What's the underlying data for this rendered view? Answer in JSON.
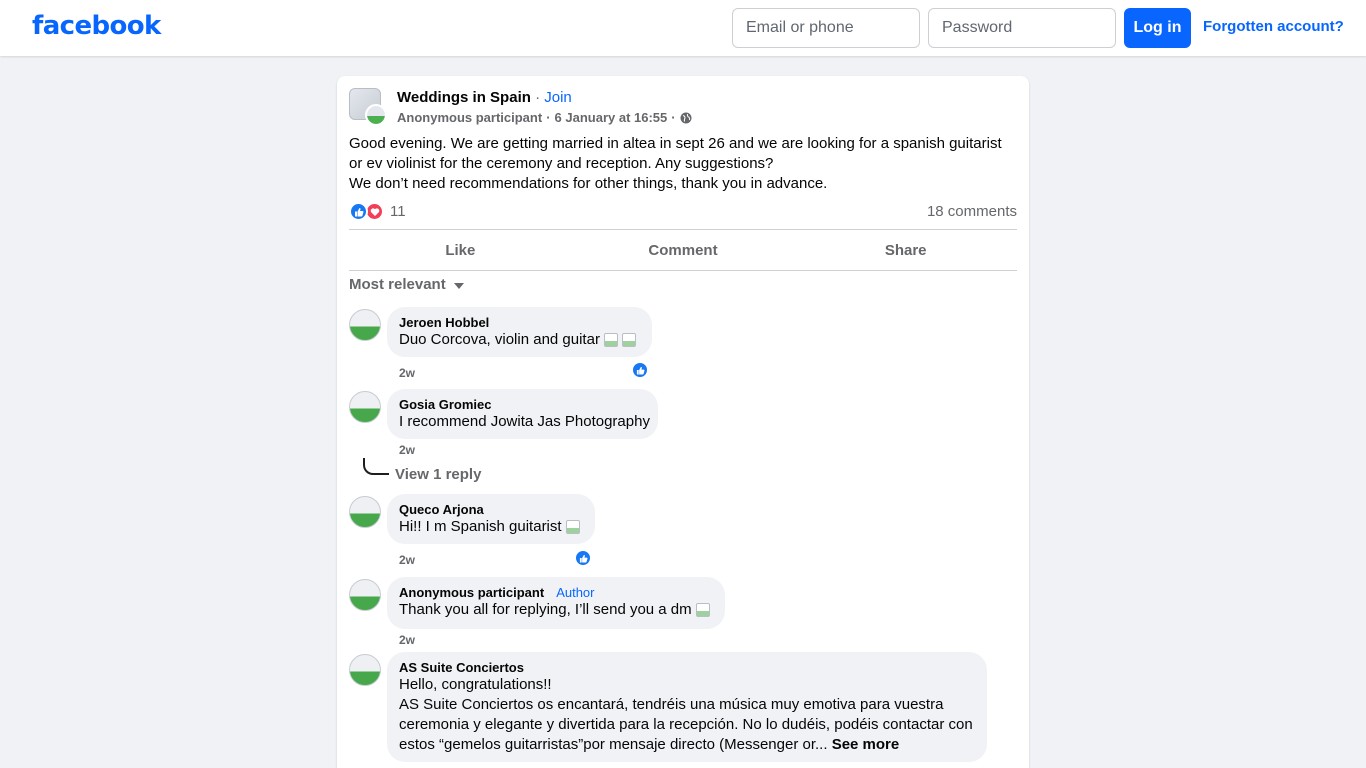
{
  "header": {
    "logo": "facebook",
    "email_placeholder": "Email or phone",
    "password_placeholder": "Password",
    "login_label": "Log in",
    "forgot_label": "Forgotten account?",
    "brand_color": "#0866ff"
  },
  "post": {
    "group_name": "Weddings in Spain",
    "separator": "·",
    "join_label": "Join",
    "author": "Anonymous participant",
    "date": "6 January at 16:55",
    "privacy_icon": "globe-icon",
    "text_lines": [
      "Good evening. We are getting married in altea in sept 26 and we are looking for a spanish guitarist",
      "or ev violinist for the ceremony and reception.  Any suggestions?",
      "We don’t need recommendations for other things, thank you in advance."
    ],
    "reaction_count": "11",
    "comments_count": "18 comments"
  },
  "actions": {
    "like": "Like",
    "comment": "Comment",
    "share": "Share"
  },
  "sort_label": "Most relevant",
  "comments": [
    {
      "name": "Jeroen Hobbel",
      "text": "Duo Corcova, violin and guitar",
      "time": "2w"
    },
    {
      "name": "Gosia Gromiec",
      "text": "I recommend Jowita Jas Photography",
      "time": "2w",
      "view_reply": "View 1 reply"
    },
    {
      "name": "Queco Arjona",
      "text": "Hi!! I m Spanish guitarist",
      "time": "2w"
    },
    {
      "name": "Anonymous participant",
      "badge": "Author",
      "text": "Thank you all for replying, I’ll send you a dm",
      "time": "2w"
    },
    {
      "name": "AS Suite Conciertos",
      "lines": [
        "Hello, congratulations!!",
        "AS Suite Conciertos os encantará, tendréis una música muy emotiva para vuestra",
        "ceremonia y elegante y divertida para la recepción. No lo dudéis, podéis contactar con",
        "estos “gemelos guitarristas”por mensaje directo (Messenger or..."
      ],
      "see_more": "See more"
    }
  ]
}
